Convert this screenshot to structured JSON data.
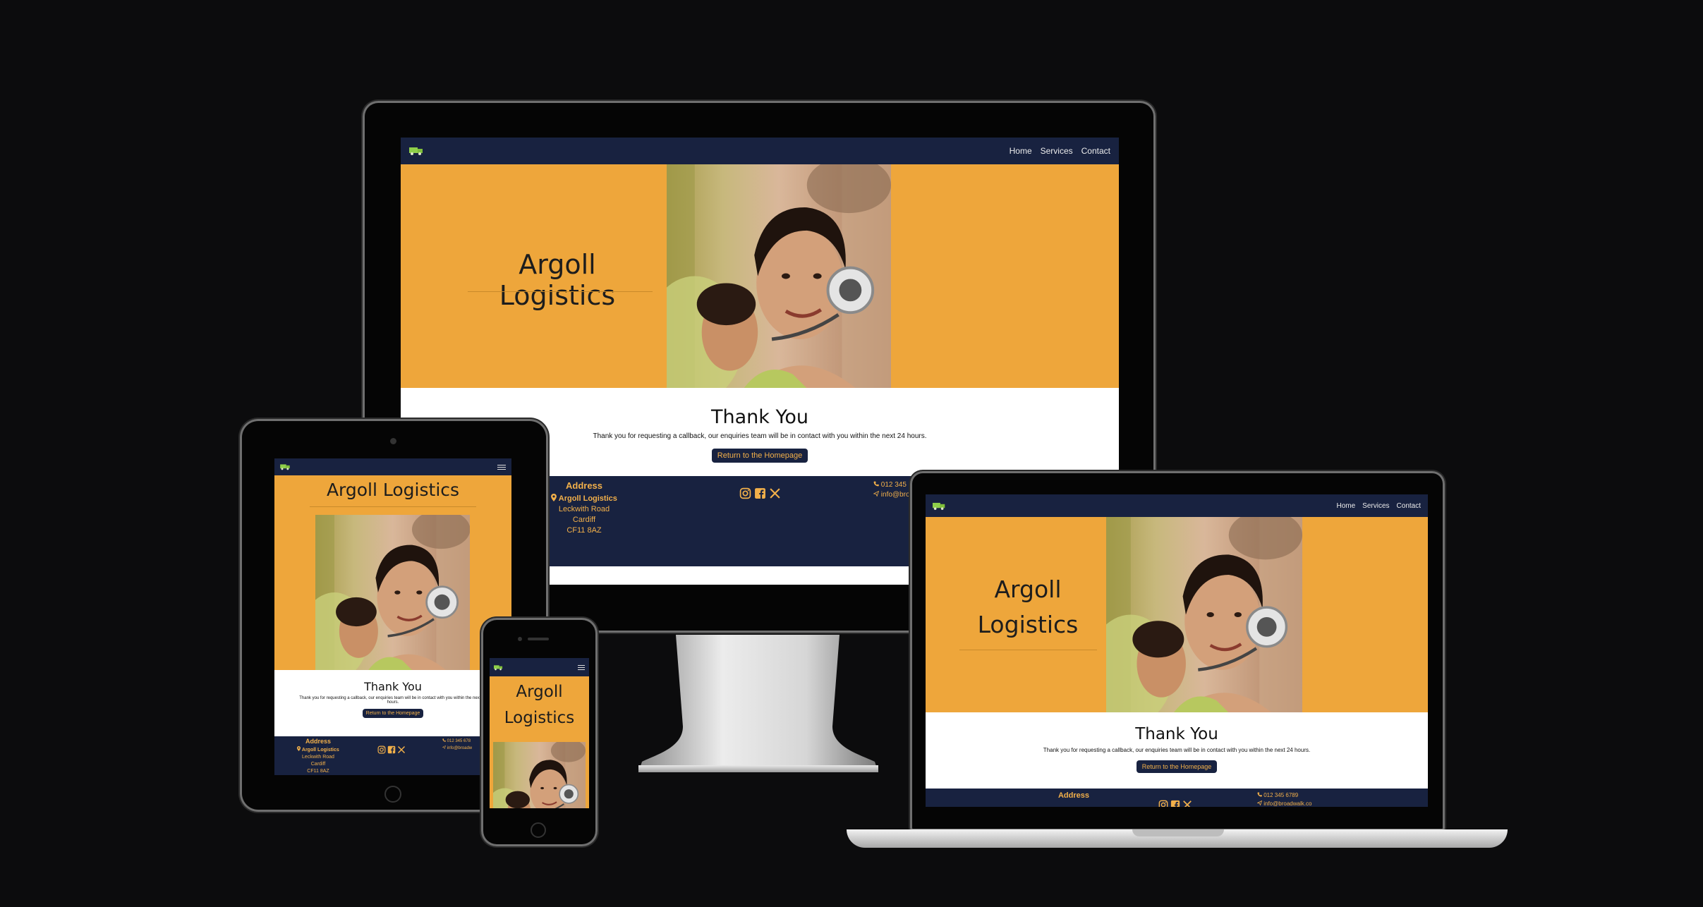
{
  "site": {
    "brand_icon": "truck-icon",
    "nav": {
      "home": "Home",
      "services": "Services",
      "contact": "Contact"
    },
    "hero_title": "Argoll Logistics",
    "hero_title_line1": "Argoll",
    "hero_title_line2": "Logistics",
    "thanks_heading": "Thank You",
    "thanks_message": "Thank you for requesting a callback, our enquiries team will be in contact with you within the next 24 hours.",
    "tablet_message_l1": "Thank you for requesting a callback, our enquiries team will be in contact with you within the next 24",
    "tablet_message_l2": "hours.",
    "return_button": "Return to the Homepage",
    "footer": {
      "address_heading": "Address",
      "company": "Argoll Logistics",
      "street": "Leckwith Road",
      "city": "Cardiff",
      "postcode": "CF11 8AZ",
      "phone_full": "012 345 6789",
      "email_full": "info@broadwalk.co",
      "phone_cut": "012 3",
      "email_cut": "info@br",
      "tablet_phone": "012 345 678",
      "tablet_email": "info@broadw",
      "social_icons": [
        "instagram-icon",
        "facebook-icon",
        "x-icon"
      ]
    }
  },
  "colors": {
    "accent": "#eea63b",
    "navy": "#182240",
    "nav_text": "#ececec",
    "footer_text": "#f2b04a",
    "logo": "#8fcf4a",
    "backdrop": "#0c0c0d"
  }
}
